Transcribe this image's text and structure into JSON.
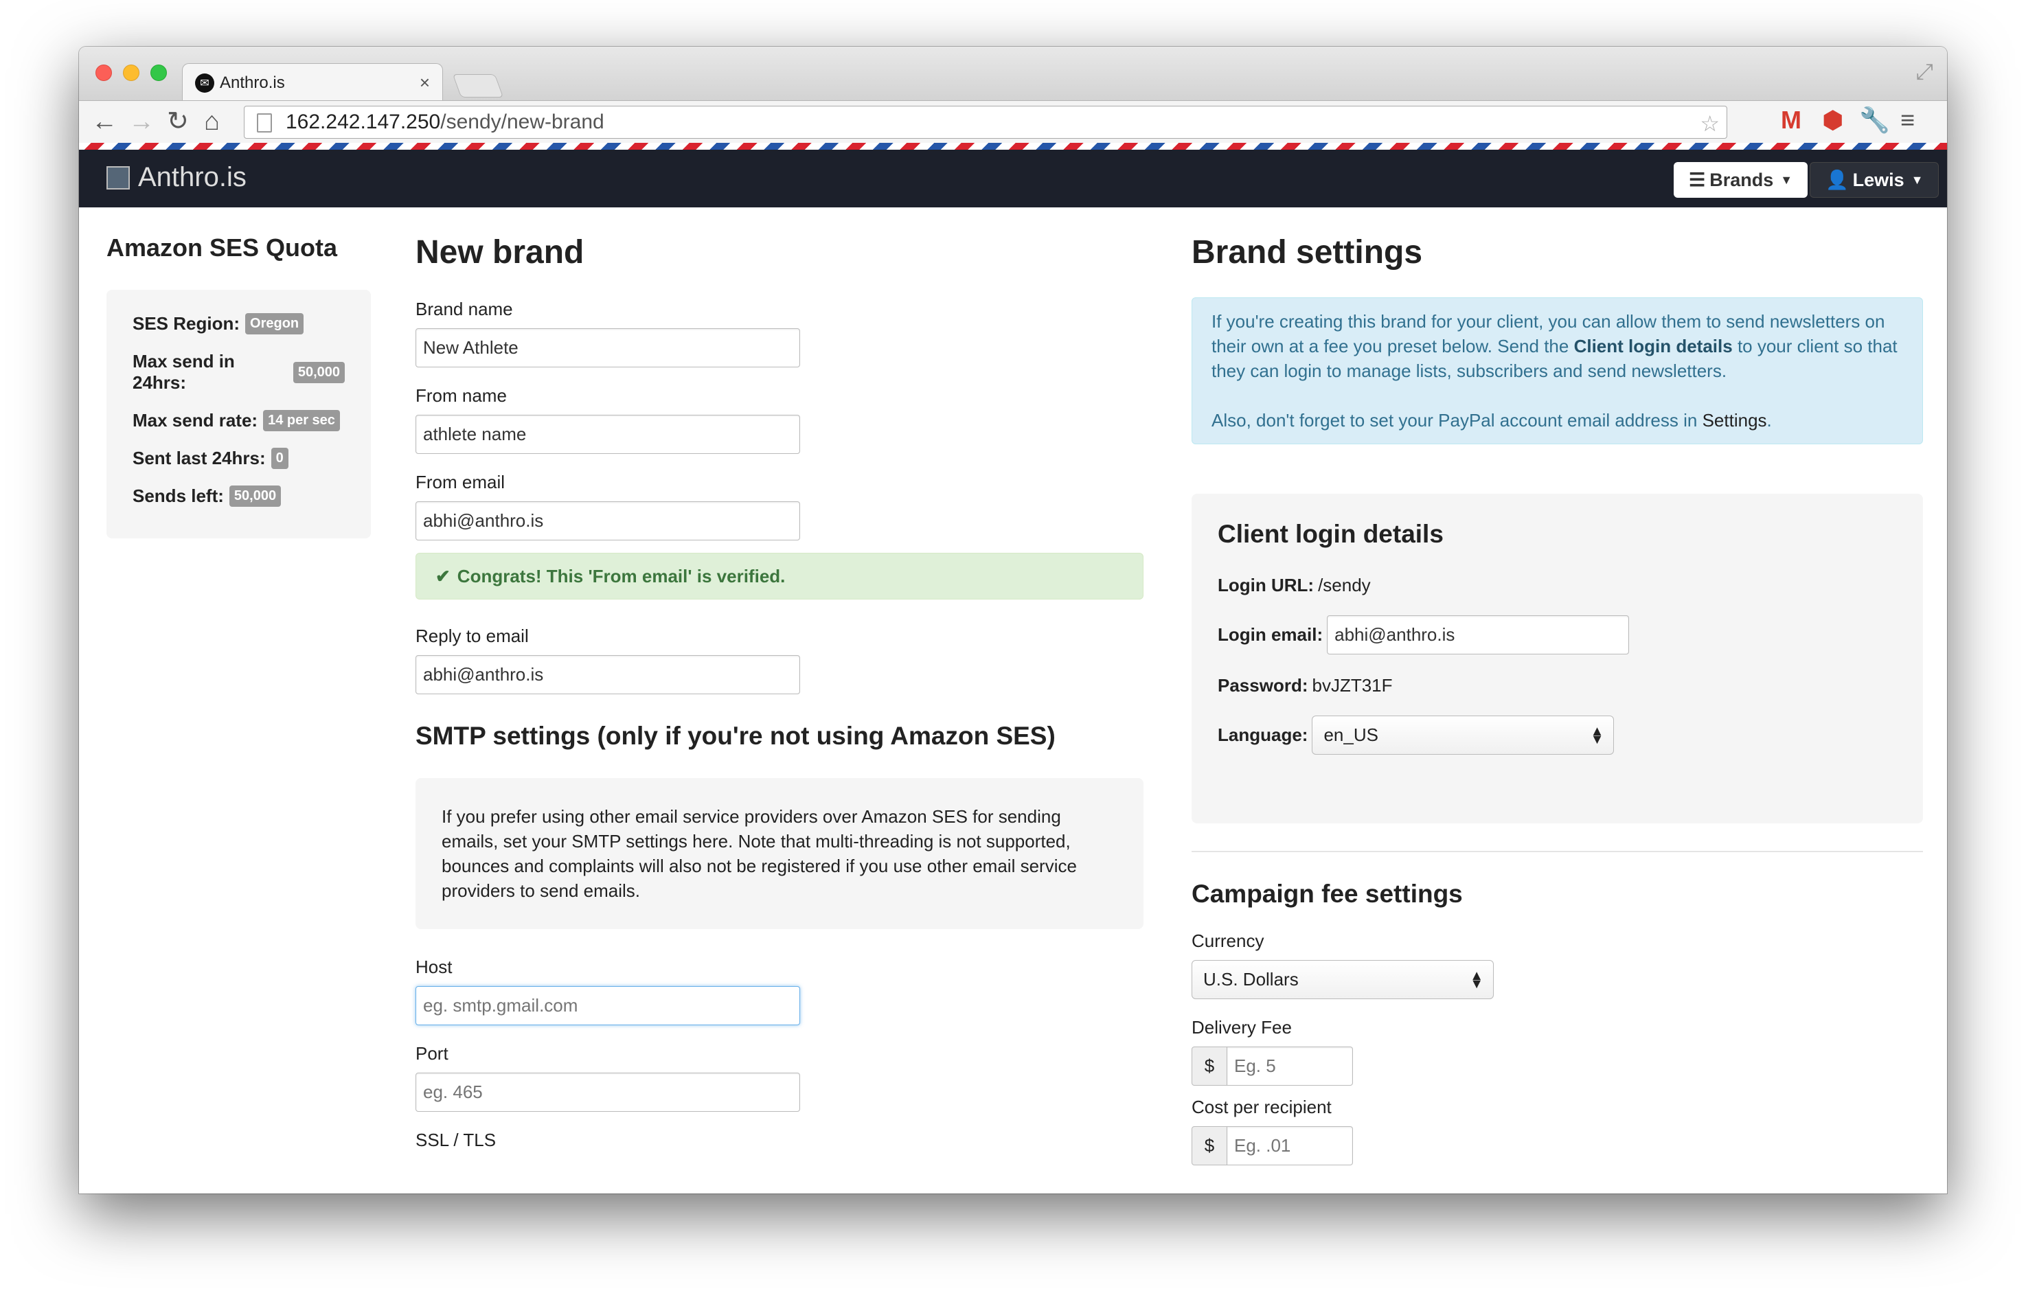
{
  "browser": {
    "tab_title": "Anthro.is",
    "tab_close": "×",
    "url_host": "162.242.147.250",
    "url_path": "/sendy/new-brand"
  },
  "navbar": {
    "brand": "Anthro.is",
    "brands_label": "Brands",
    "user_label": "Lewis"
  },
  "sidebar": {
    "title": "Amazon SES Quota",
    "rows": [
      {
        "label": "SES Region:",
        "value": "Oregon"
      },
      {
        "label": "Max send in 24hrs:",
        "value": "50,000"
      },
      {
        "label": "Max send rate:",
        "value": "14 per sec"
      },
      {
        "label": "Sent last 24hrs:",
        "value": "0"
      },
      {
        "label": "Sends left:",
        "value": "50,000"
      }
    ]
  },
  "new_brand": {
    "title": "New brand",
    "brand_name_label": "Brand name",
    "brand_name_value": "New Athlete",
    "from_name_label": "From name",
    "from_name_value": "athlete name",
    "from_email_label": "From email",
    "from_email_value": "abhi@anthro.is",
    "verified_msg": "Congrats! This 'From email' is verified.",
    "reply_label": "Reply to email",
    "reply_value": "abhi@anthro.is",
    "smtp_title": "SMTP settings (only if you're not using Amazon SES)",
    "smtp_note": "If you prefer using other email service providers over Amazon SES for sending emails, set your SMTP settings here. Note that multi-threading is not supported, bounces and complaints will also not be registered if you use other email service providers to send emails.",
    "host_label": "Host",
    "host_placeholder": "eg. smtp.gmail.com",
    "port_label": "Port",
    "port_placeholder": "eg. 465",
    "ssl_label": "SSL / TLS"
  },
  "brand_settings": {
    "title": "Brand settings",
    "info_part1": "If you're creating this brand for your client, you can allow them to send newsletters on their own at a fee you preset below. Send the ",
    "info_bold": "Client login details",
    "info_part2": " to your client so that they can login to manage lists, subscribers and send newsletters.",
    "info_line2": "Also, don't forget to set your PayPal account email address in ",
    "info_settings": "Settings",
    "info_period": ".",
    "client_title": "Client login details",
    "login_url_label": "Login URL:",
    "login_url_value": "/sendy",
    "login_email_label": "Login email:",
    "login_email_value": "abhi@anthro.is",
    "password_label": "Password:",
    "password_value": "bvJZT31F",
    "language_label": "Language:",
    "language_value": "en_US",
    "fee_title": "Campaign fee settings",
    "currency_label": "Currency",
    "currency_value": "U.S. Dollars",
    "delivery_label": "Delivery Fee",
    "delivery_placeholder": "Eg. 5",
    "cost_label": "Cost per recipient",
    "cost_placeholder": "Eg. .01",
    "dollar": "$"
  },
  "colors": {
    "navbar": "#1c202b",
    "success_bg": "#dff0d8",
    "info_bg": "#d9edf7"
  }
}
